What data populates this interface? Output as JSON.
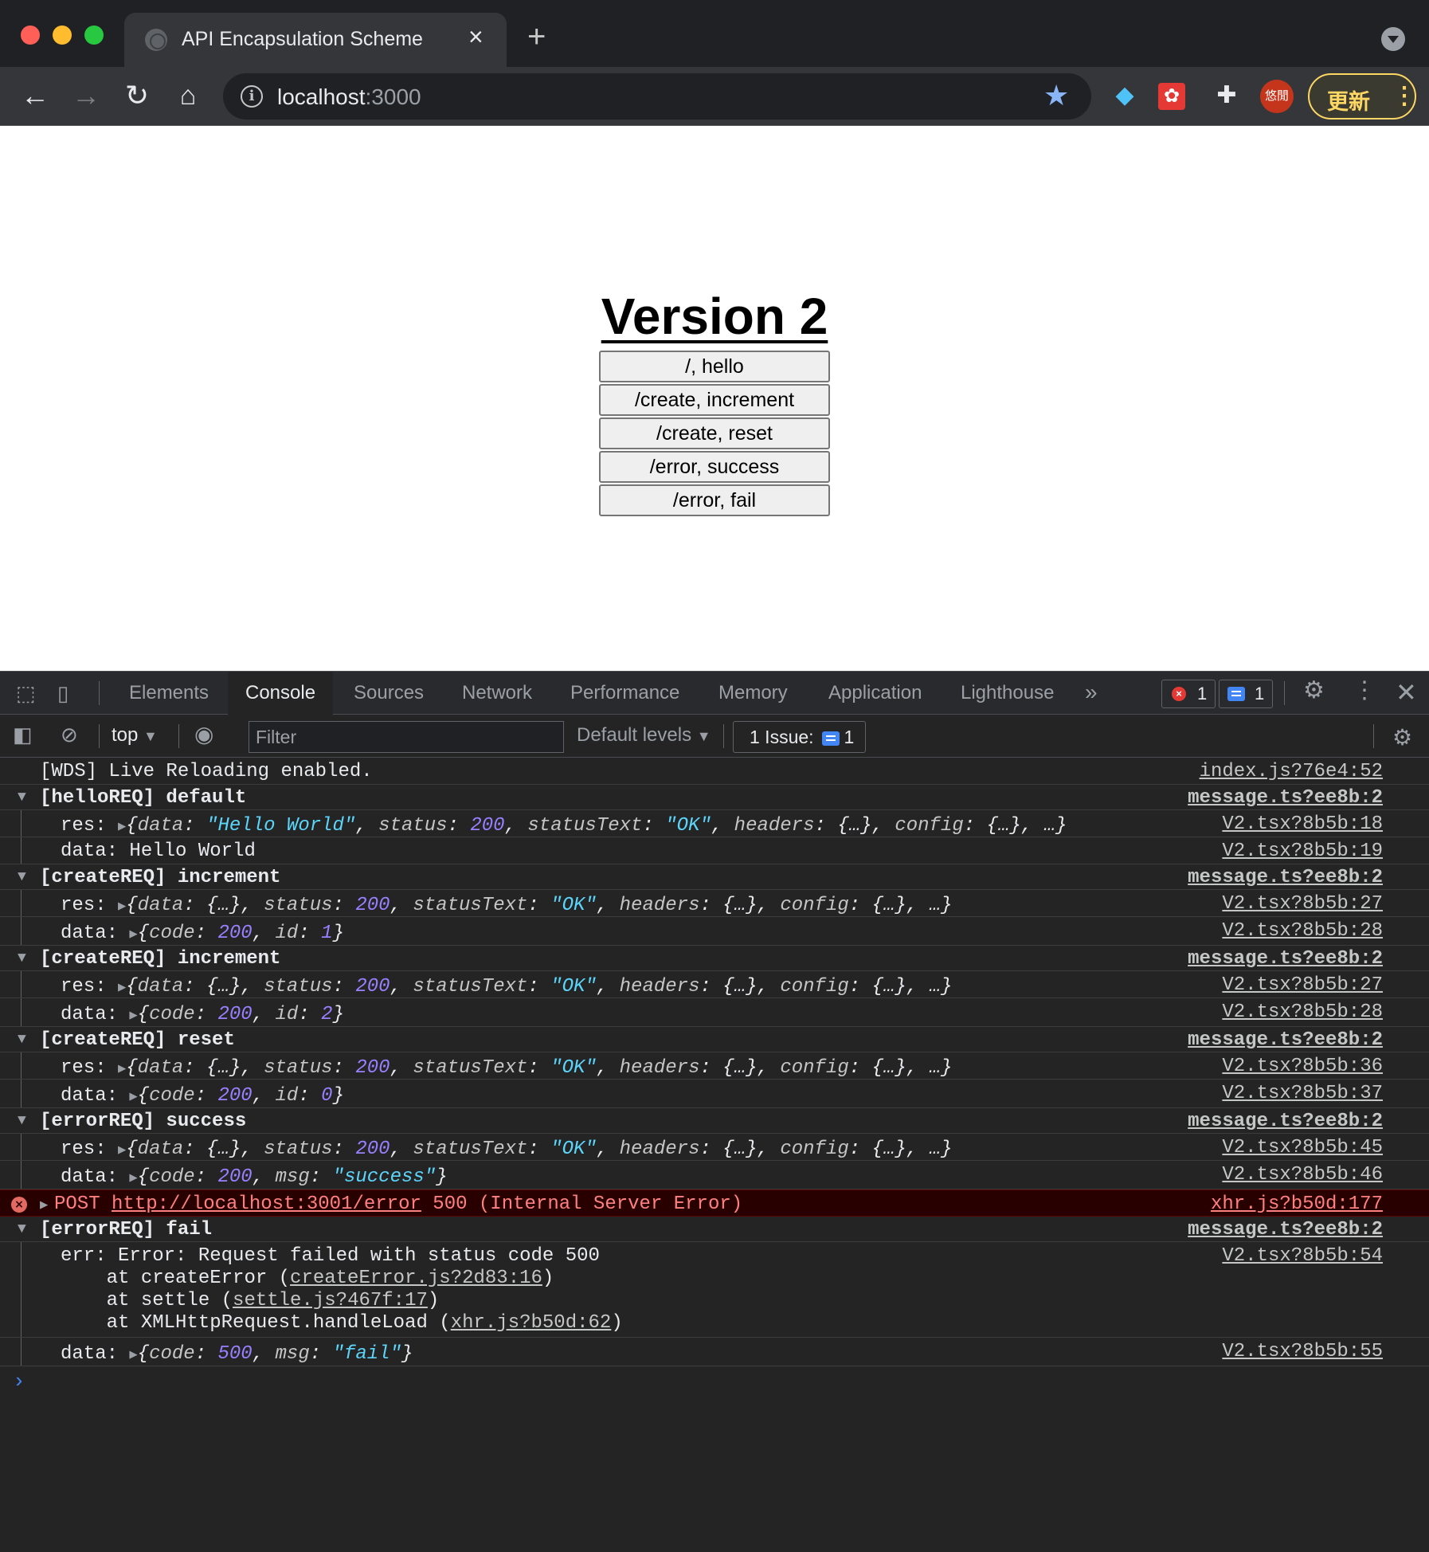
{
  "browser": {
    "tab_title": "API Encapsulation Scheme",
    "url_host": "localhost",
    "url_port": ":3000",
    "avatar_text": "悠閒",
    "update_label": "更新",
    "accent_color": "#8ab4f8",
    "update_color": "#fdd663"
  },
  "page": {
    "heading": "Version 2",
    "buttons": [
      "/, hello",
      "/create, increment",
      "/create, reset",
      "/error, success",
      "/error, fail"
    ]
  },
  "devtools": {
    "tabs": [
      "Elements",
      "Console",
      "Sources",
      "Network",
      "Performance",
      "Memory",
      "Application",
      "Lighthouse"
    ],
    "active_tab": "Console",
    "error_count": "1",
    "message_count": "1",
    "context": "top",
    "filter_placeholder": "Filter",
    "levels_label": "Default levels",
    "issues_label": "1 Issue:",
    "issues_count": "1"
  },
  "console": {
    "wds": {
      "text": "[WDS] Live Reloading enabled.",
      "src": "index.js?76e4:52"
    },
    "g1": {
      "title": "[helloREQ] default",
      "src": "message.ts?ee8b:2",
      "res_label": "res: ",
      "res_src": "V2.tsx?8b5b:18",
      "data_text": "data: Hello World",
      "data_src": "V2.tsx?8b5b:19"
    },
    "g2": {
      "title": "[createREQ] increment",
      "src": "message.ts?ee8b:2",
      "res_src": "V2.tsx?8b5b:27",
      "data_id": "1",
      "data_src": "V2.tsx?8b5b:28"
    },
    "g3": {
      "title": "[createREQ] increment",
      "src": "message.ts?ee8b:2",
      "res_src": "V2.tsx?8b5b:27",
      "data_id": "2",
      "data_src": "V2.tsx?8b5b:28"
    },
    "g4": {
      "title": "[createREQ] reset",
      "src": "message.ts?ee8b:2",
      "res_src": "V2.tsx?8b5b:36",
      "data_id": "0",
      "data_src": "V2.tsx?8b5b:37"
    },
    "g5": {
      "title": "[errorREQ] success",
      "src": "message.ts?ee8b:2",
      "res_src": "V2.tsx?8b5b:45",
      "data_msg": "\"success\"",
      "data_src": "V2.tsx?8b5b:46"
    },
    "err": {
      "method": "POST ",
      "url": "http://localhost:3001/error",
      "status": " 500 (Internal Server Error)",
      "src": "xhr.js?b50d:177"
    },
    "g6": {
      "title": "[errorREQ] fail",
      "src": "message.ts?ee8b:2",
      "err_line": "err: Error: Request failed with status code 500",
      "err_src": "V2.tsx?8b5b:54",
      "stack1_pre": "    at createError (",
      "stack1_link": "createError.js?2d83:16",
      "stack1_post": ")",
      "stack2_pre": "    at settle (",
      "stack2_link": "settle.js?467f:17",
      "stack2_post": ")",
      "stack3_pre": "    at XMLHttpRequest.handleLoad (",
      "stack3_link": "xhr.js?b50d:62",
      "stack3_post": ")",
      "data_code": "500",
      "data_msg": "\"fail\"",
      "data_src": "V2.tsx?8b5b:55"
    },
    "tokens": {
      "res": "res: ",
      "data": "data: ",
      "open": "{",
      "close": "}",
      "comma": ", ",
      "k_data": "data",
      "k_status": "status",
      "k_statusText": "statusText",
      "k_headers": "headers",
      "k_config": "config",
      "k_code": "code",
      "k_id": "id",
      "k_msg": "msg",
      "colon": ": ",
      "v_hello": "\"Hello World\"",
      "v_200": "200",
      "v_ok": "\"OK\"",
      "v_obj": "{…}",
      "v_more": "…"
    }
  }
}
